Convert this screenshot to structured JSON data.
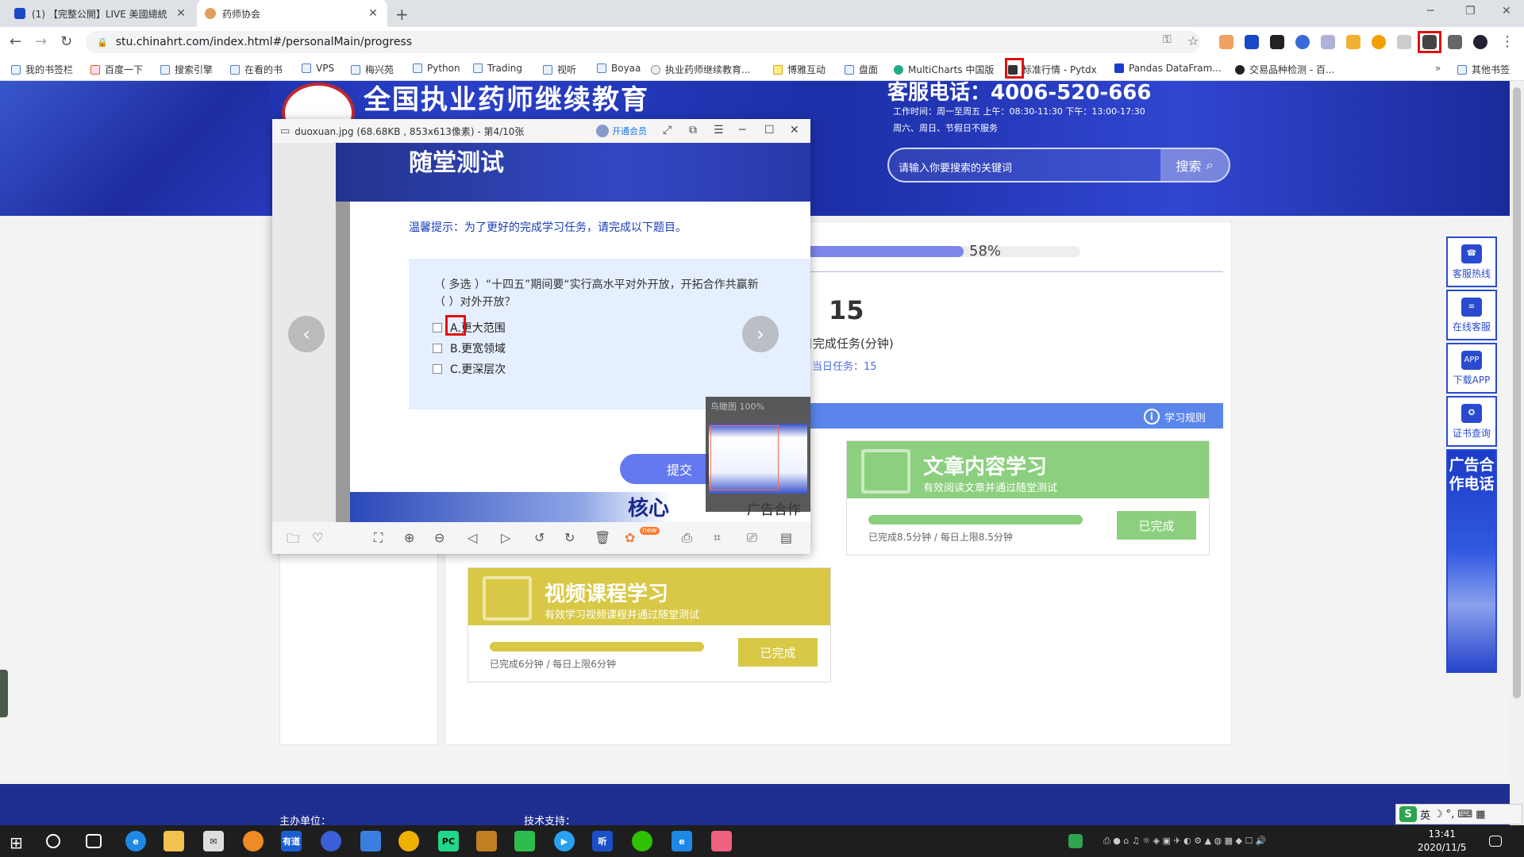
{
  "browser": {
    "tabs": [
      {
        "title": "(1) 【完整公開】LIVE 美國總統",
        "active": false
      },
      {
        "title": "药师协会",
        "active": true
      }
    ],
    "url": "stu.chinahrt.com/index.html#/personalMain/progress",
    "bookmarks": [
      "我的书签栏",
      "百度一下",
      "搜索引擎",
      "在看的书",
      "VPS",
      "梅兴苑",
      "Python",
      "Trading",
      "视听",
      "Boyaa",
      "执业药师继续教育...",
      "博雅互动",
      "盘面",
      "MultiCharts 中国版",
      "标准行情 - Pytdx",
      "Pandas DataFram...",
      "交易品种检测 - 百...",
      "其他书签"
    ]
  },
  "site": {
    "banner_title": "全国执业药师继续教育",
    "hotline": "客服电话：4006-520-666",
    "work_hours_1": "工作时间：周一至周五 上午：08:30-11:30 下午：13:00-17:30",
    "work_hours_2": "周六、周日、节假日不服务",
    "search_placeholder": "请输入你要搜索的关键词",
    "search_button": "搜索"
  },
  "progress": {
    "percent_label": "58%",
    "percent_value": 58,
    "daily_minutes": "15",
    "daily_minutes_label": "日完成任务(分钟)",
    "daily_task": "当日任务：15",
    "rules_label": "学习规则"
  },
  "cards": {
    "article": {
      "title": "文章内容学习",
      "subtitle": "有效阅读文章并通过随堂测试",
      "done_text": "已完成8.5分钟 / 每日上限8.5分钟",
      "button": "已完成",
      "color": "#8ccf7e"
    },
    "video": {
      "title": "视频课程学习",
      "subtitle": "有效学习视频课程并通过随堂测试",
      "done_text": "已完成6分钟 / 每日上限6分钟",
      "button": "已完成",
      "color": "#d8c845"
    }
  },
  "footer": {
    "left": "主办单位：",
    "right": "技术支持："
  },
  "sidebar": {
    "items": [
      "客服热线",
      "在线客服",
      "下载APP",
      "证书查询"
    ],
    "ad": "广告合作电话"
  },
  "viewer": {
    "title": "duoxuan.jpg (68.68KB , 853x613像素) - 第4/10张",
    "vip": "开通会员",
    "thumb_label": "鸟瞰图 100%",
    "toolbar_new": "new"
  },
  "quiz": {
    "banner": "随堂测试",
    "tip": "温馨提示：为了更好的完成学习任务，请完成以下题目。",
    "question_line1": "（ 多选 ）“十四五”期间要“实行高水平对外开放，开拓合作共赢新",
    "question_line2": "（    ）对外开放？",
    "options": [
      "A.更大范围",
      "B.更宽领域",
      "C.更深层次"
    ],
    "submit": "提交",
    "bottom_text": "核心",
    "bottom_ad": "广告合作"
  },
  "taskbar": {
    "time": "13:41",
    "date": "2020/11/5",
    "ime_lang": "英"
  }
}
